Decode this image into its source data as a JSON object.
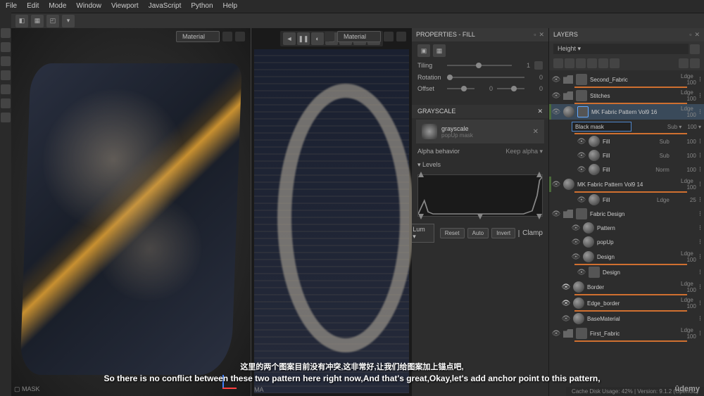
{
  "menu": [
    "File",
    "Edit",
    "Mode",
    "Window",
    "Viewport",
    "JavaScript",
    "Python",
    "Help"
  ],
  "viewport": {
    "material_label": "Material",
    "mask_label": "MASK",
    "mat_label": "MA"
  },
  "props": {
    "title": "PROPERTIES - FILL",
    "tiling": {
      "label": "Tiling",
      "val": "1"
    },
    "rotation": {
      "label": "Rotation",
      "val": "0"
    },
    "offset": {
      "label": "Offset",
      "val_x": "0",
      "val_y": "0"
    },
    "grayscale_title": "GRAYSCALE",
    "source": {
      "name": "grayscale",
      "sub": "popUp mask"
    },
    "alpha": {
      "label": "Alpha behavior",
      "value": "Keep alpha"
    },
    "levels_label": "Levels",
    "lum": "Lum",
    "reset": "Reset",
    "auto": "Auto",
    "invert": "Invert",
    "clamp": "Clamp"
  },
  "layers": {
    "title": "LAYERS",
    "channel": "Height",
    "mask_input": "Black mask",
    "sub_label": "Sub",
    "norm_label": "Norm",
    "ldge_label": "Ldge",
    "items": [
      {
        "name": "Second_Fabric",
        "type": "folder",
        "op": "100"
      },
      {
        "name": "Stitches",
        "type": "folder",
        "op": "100"
      },
      {
        "name": "MK Fabric Pattern Vol9 16",
        "type": "group",
        "op": "100",
        "selected": true,
        "green": true
      },
      {
        "name": "Fill",
        "type": "fill",
        "op": "100",
        "indent": 3,
        "mode": "Sub"
      },
      {
        "name": "Fill",
        "type": "fill",
        "op": "100",
        "indent": 3,
        "mode": "Sub"
      },
      {
        "name": "Fill",
        "type": "fill",
        "op": "100",
        "indent": 3,
        "mode": "Norm"
      },
      {
        "name": "MK Fabric Pattern Vol9 14",
        "type": "group",
        "op": "100",
        "green": true
      },
      {
        "name": "Fill",
        "type": "fill",
        "op": "25",
        "indent": 3,
        "mode": "Ldge"
      },
      {
        "name": "Fabric Design",
        "type": "folder",
        "op": ""
      },
      {
        "name": "Pattern",
        "type": "layer",
        "op": "",
        "indent": 2
      },
      {
        "name": "popUp",
        "type": "layer",
        "op": "",
        "indent": 2
      },
      {
        "name": "Design",
        "type": "layer",
        "op": "100",
        "indent": 2,
        "ldge": true
      },
      {
        "name": "Design",
        "type": "sub",
        "op": "",
        "indent": 3
      },
      {
        "name": "Border",
        "type": "layer",
        "op": "100",
        "indent": 1,
        "ldge": true,
        "eye_on": true
      },
      {
        "name": "Edge_border",
        "type": "layer",
        "op": "100",
        "indent": 1,
        "ldge": true,
        "eye_on": true
      },
      {
        "name": "BaseMaterial",
        "type": "layer",
        "op": "",
        "indent": 1
      },
      {
        "name": "First_Fabric",
        "type": "folder",
        "op": "100",
        "ldge": true
      }
    ]
  },
  "status": "Cache Disk Usage:   42%  | Version: 9.1.2 (OpenGL)",
  "subtitles": {
    "cn": "这里的两个图案目前没有冲突,这非常好,让我们给图案加上锚点吧,",
    "en": "So there is no conflict between these two pattern here right now,And that's great,Okay,let's add anchor point to this pattern,"
  },
  "brand": "ûdemy"
}
